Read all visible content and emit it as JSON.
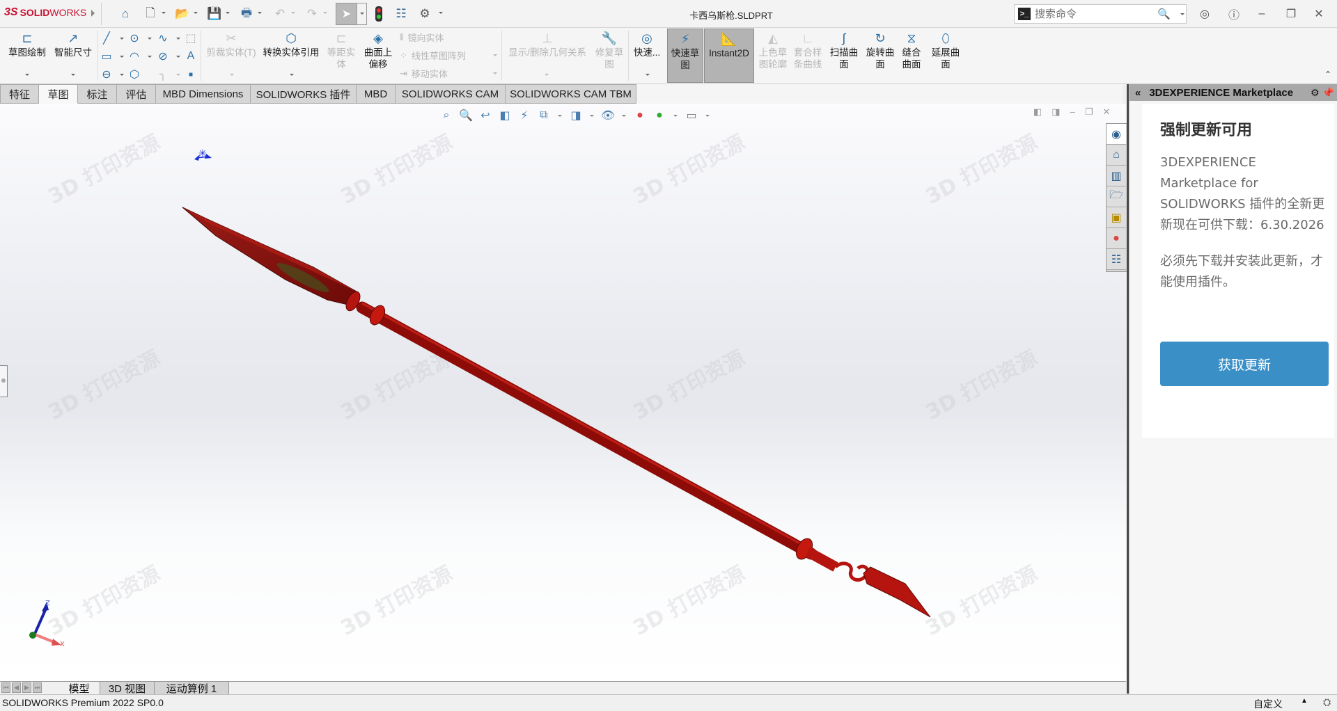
{
  "app": {
    "brand_prefix": "3S",
    "brand_bold": "SOLID",
    "brand_light": "WORKS",
    "document_title": "卡西乌斯枪.SLDPRT"
  },
  "quick_access": {
    "icons": [
      "home-icon",
      "new-document-icon",
      "open-icon",
      "save-icon",
      "print-icon",
      "undo-icon",
      "redo-icon",
      "select-pointer-icon",
      "rebuild-icon",
      "file-properties-icon",
      "options-gear-icon"
    ]
  },
  "search": {
    "placeholder": "搜索命令"
  },
  "window_controls": [
    "user-icon",
    "help-icon",
    "minimize-icon",
    "restore-icon",
    "close-icon"
  ],
  "ribbon": {
    "sketch": "草图绘制",
    "smart_dim": "智能尺寸",
    "trim": "剪裁实体(T)",
    "convert": "转换实体引用",
    "offset_line1": "等距实",
    "offset_line2": "体",
    "surface_offset_line1": "曲面上",
    "surface_offset_line2": "偏移",
    "mirror": "镜向实体",
    "linear_pattern": "线性草图阵列",
    "move": "移动实体",
    "show_relations": "显示/删除几何关系",
    "repair_line1": "修复草",
    "repair_line2": "图",
    "quick_snaps": "快速...",
    "rapid_sketch_line1": "快速草",
    "rapid_sketch_line2": "图",
    "instant2d": "Instant2D",
    "shaded_line1": "上色草",
    "shaded_line2": "图轮廓",
    "fit_spline_line1": "套合样",
    "fit_spline_line2": "条曲线",
    "swept_line1": "扫描曲",
    "swept_line2": "面",
    "revolved_line1": "旋转曲",
    "revolved_line2": "面",
    "knit_line1": "缝合",
    "knit_line2": "曲面",
    "extend_line1": "延展曲",
    "extend_line2": "面"
  },
  "command_tabs": [
    {
      "label": "特征",
      "active": false
    },
    {
      "label": "草图",
      "active": true
    },
    {
      "label": "标注",
      "active": false
    },
    {
      "label": "评估",
      "active": false
    },
    {
      "label": "MBD Dimensions",
      "active": false
    },
    {
      "label": "SOLIDWORKS 插件",
      "active": false
    },
    {
      "label": "MBD",
      "active": false
    },
    {
      "label": "SOLIDWORKS CAM",
      "active": false
    },
    {
      "label": "SOLIDWORKS CAM TBM",
      "active": false
    }
  ],
  "heads_up_toolbar": [
    "zoom-to-fit-icon",
    "zoom-to-area-icon",
    "previous-view-icon",
    "section-view-icon",
    "dynamic-annotation-icon",
    "view-orientation-icon",
    "display-style-icon",
    "hide-show-icon",
    "edit-appearance-icon",
    "apply-scene-icon",
    "view-settings-icon"
  ],
  "viewport": {
    "model_color": "#c8140f",
    "axes": {
      "z": "Z",
      "x": "X"
    }
  },
  "task_pane": {
    "title": "3DEXPERIENCE Marketplace",
    "heading": "强制更新可用",
    "message": "3DEXPERIENCE Marketplace for SOLIDWORKS 插件的全新更新现在可供下载：6.30.2026",
    "message2": "必须先下载并安装此更新，才能使用插件。",
    "button": "获取更新",
    "button_color": "#3a8fc7",
    "tabs": [
      "3dexperience-icon",
      "home-icon",
      "design-library-icon",
      "file-explorer-icon",
      "view-palette-icon",
      "appearances-icon",
      "custom-properties-icon"
    ]
  },
  "bottom_tabs": [
    {
      "label": "模型",
      "active": true
    },
    {
      "label": "3D 视图",
      "active": false
    },
    {
      "label": "运动算例 1",
      "active": false
    }
  ],
  "status_bar": {
    "version": "SOLIDWORKS Premium 2022 SP0.0",
    "units": "自定义"
  }
}
